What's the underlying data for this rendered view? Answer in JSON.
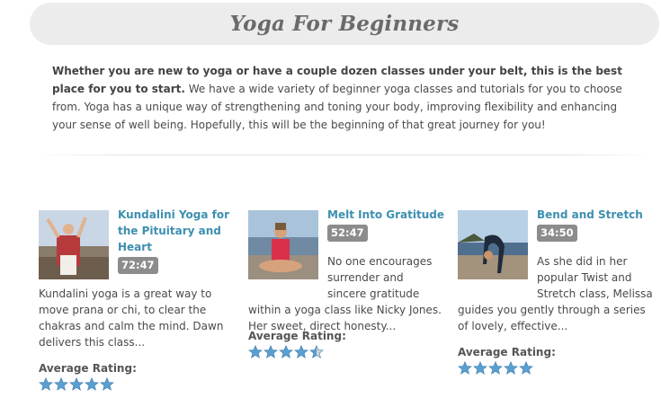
{
  "page": {
    "title": "Yoga For Beginners",
    "intro_bold": "Whether you are new to yoga or have a couple dozen classes under your belt, this is the best place for you to start.",
    "intro_rest": " We have a wide variety of beginner yoga classes and tutorials for you to choose from. Yoga has a unique way of strengthening and toning your body, improving flexibility and enhancing your sense of well being. Hopefully, this will be the beginning of that great journey for you!"
  },
  "videos": [
    {
      "title": "Kundalini Yoga for the Pituitary and Heart",
      "duration": "72:47",
      "description": "Kundalini yoga is a great way to move prana or chi, to clear the chakras and calm the mind. Dawn delivers this class...",
      "rating_label": "Average Rating:",
      "rating": 5
    },
    {
      "title": "Melt Into Gratitude",
      "duration": "52:47",
      "description": "No one encourages surrender and sincere gratitude within a yoga class like Nicky Jones. Her sweet, direct honesty...",
      "rating_label": "Average Rating:",
      "rating": 4.5
    },
    {
      "title": "Bend and Stretch",
      "duration": "34:50",
      "description": "As she did in her popular Twist and Stretch class, Melissa guides you gently through a series of lovely, effective...",
      "rating_label": "Average Rating:",
      "rating": 5
    }
  ],
  "colors": {
    "link": "#3d8fb0",
    "star": "#5a9fd0",
    "badge": "#8c8c8c"
  }
}
